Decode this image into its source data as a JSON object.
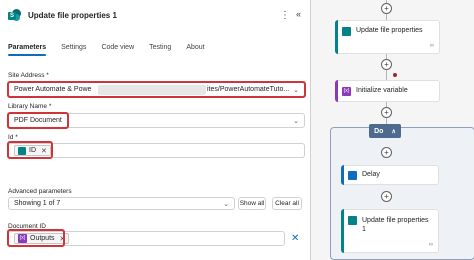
{
  "header": {
    "title": "Update file properties 1",
    "kebab": "⋮",
    "collapse": "«"
  },
  "tabs": [
    "Parameters",
    "Settings",
    "Code view",
    "Testing",
    "About"
  ],
  "site_address": {
    "label": "Site Address *",
    "value_left": "Power Automate & Powe",
    "value_right": "ites/PowerAutomateTuto..."
  },
  "library_name": {
    "label": "Library Name *",
    "value": "PDF Document"
  },
  "id_field": {
    "label": "Id *",
    "chip": "ID"
  },
  "advanced": {
    "label": "Advanced parameters",
    "showing": "Showing 1 of 7",
    "show_all": "Show all",
    "clear_all": "Clear all"
  },
  "document_id": {
    "label": "Document ID",
    "chip": "Outputs"
  },
  "flow": {
    "card1": "Update file properties",
    "card2": "Initialize variable",
    "do_label": "Do",
    "card3": "Delay",
    "card4_line1": "Update file properties",
    "card4_line2": "1"
  }
}
